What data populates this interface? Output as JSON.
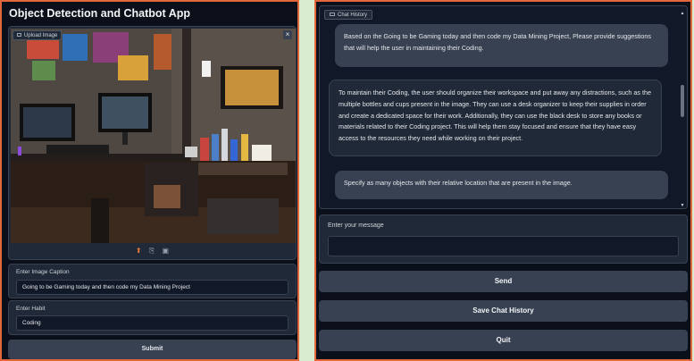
{
  "left": {
    "title": "Object Detection and Chatbot App",
    "upload_tag": "Upload Image",
    "close": "×",
    "caption": {
      "label": "Enter Image Caption",
      "value": "Going to be Gaming today and then code my Data Mining Project"
    },
    "habit": {
      "label": "Enter Habit",
      "value": "Coding"
    },
    "submit_label": "Submit"
  },
  "right": {
    "chat_tag": "Chat History",
    "messages": [
      {
        "role": "user",
        "text": "Based on the Going to be Gaming today and then code my Data Mining Project, Please provide suggestions that will help the user in maintaining their Coding."
      },
      {
        "role": "bot",
        "text": "To maintain their Coding, the user should organize their workspace and put away any distractions, such as the multiple bottles and cups present in the image. They can use a desk organizer to keep their supplies in order and create a dedicated space for their work. Additionally, they can use the black desk to store any books or materials related to their Coding project. This will help them stay focused and ensure that they have easy access to the resources they need while working on their project."
      },
      {
        "role": "user",
        "text": "Specify as many objects with their relative location that are present in the image."
      }
    ],
    "message_label": "Enter your message",
    "send_label": "Send",
    "save_label": "Save Chat History",
    "quit_label": "Quit"
  },
  "colors": {
    "accent_border": "#e2683c",
    "background": "#0b0f19",
    "panel": "#1f2937",
    "button": "#374151"
  }
}
